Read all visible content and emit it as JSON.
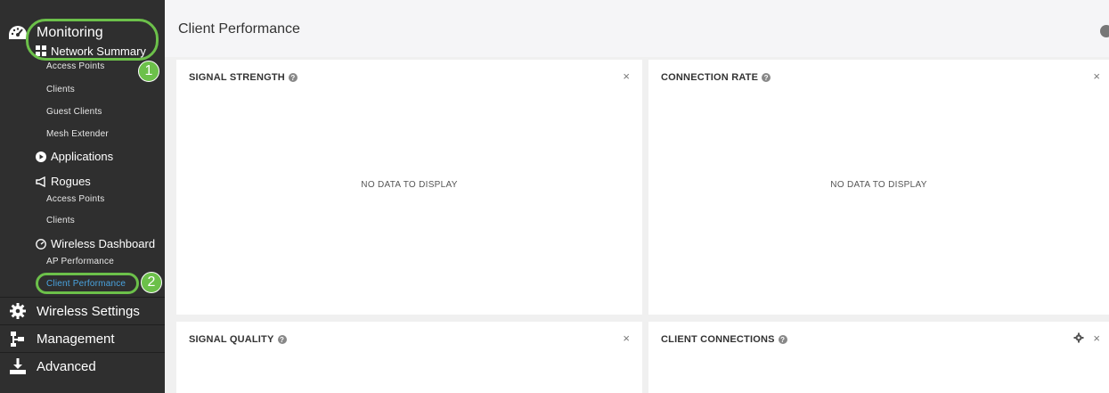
{
  "sidebar": {
    "monitoring": "Monitoring",
    "network_summary": "Network Summary",
    "ns_items": [
      "Access Points",
      "Clients",
      "Guest Clients",
      "Mesh Extender"
    ],
    "applications": "Applications",
    "rogues": "Rogues",
    "rogues_items": [
      "Access Points",
      "Clients"
    ],
    "wireless_dashboard": "Wireless Dashboard",
    "wd_items": [
      "AP Performance",
      "Client Performance"
    ],
    "menu": [
      "Wireless Settings",
      "Management",
      "Advanced"
    ]
  },
  "annotations": {
    "badge1": "1",
    "badge2": "2",
    "highlight_color": "#6cc04a"
  },
  "main": {
    "title": "Client Performance",
    "panels": [
      {
        "title": "SIGNAL STRENGTH",
        "message": "NO DATA TO DISPLAY"
      },
      {
        "title": "CONNECTION RATE",
        "message": "NO DATA TO DISPLAY"
      },
      {
        "title": "SIGNAL QUALITY"
      },
      {
        "title": "CLIENT CONNECTIONS"
      }
    ],
    "help_glyph": "?",
    "close_glyph": "×"
  },
  "colors": {
    "sidebar_bg": "#2f2f2f",
    "active_link": "#4aa3df",
    "main_bg": "#f0f0f0"
  }
}
